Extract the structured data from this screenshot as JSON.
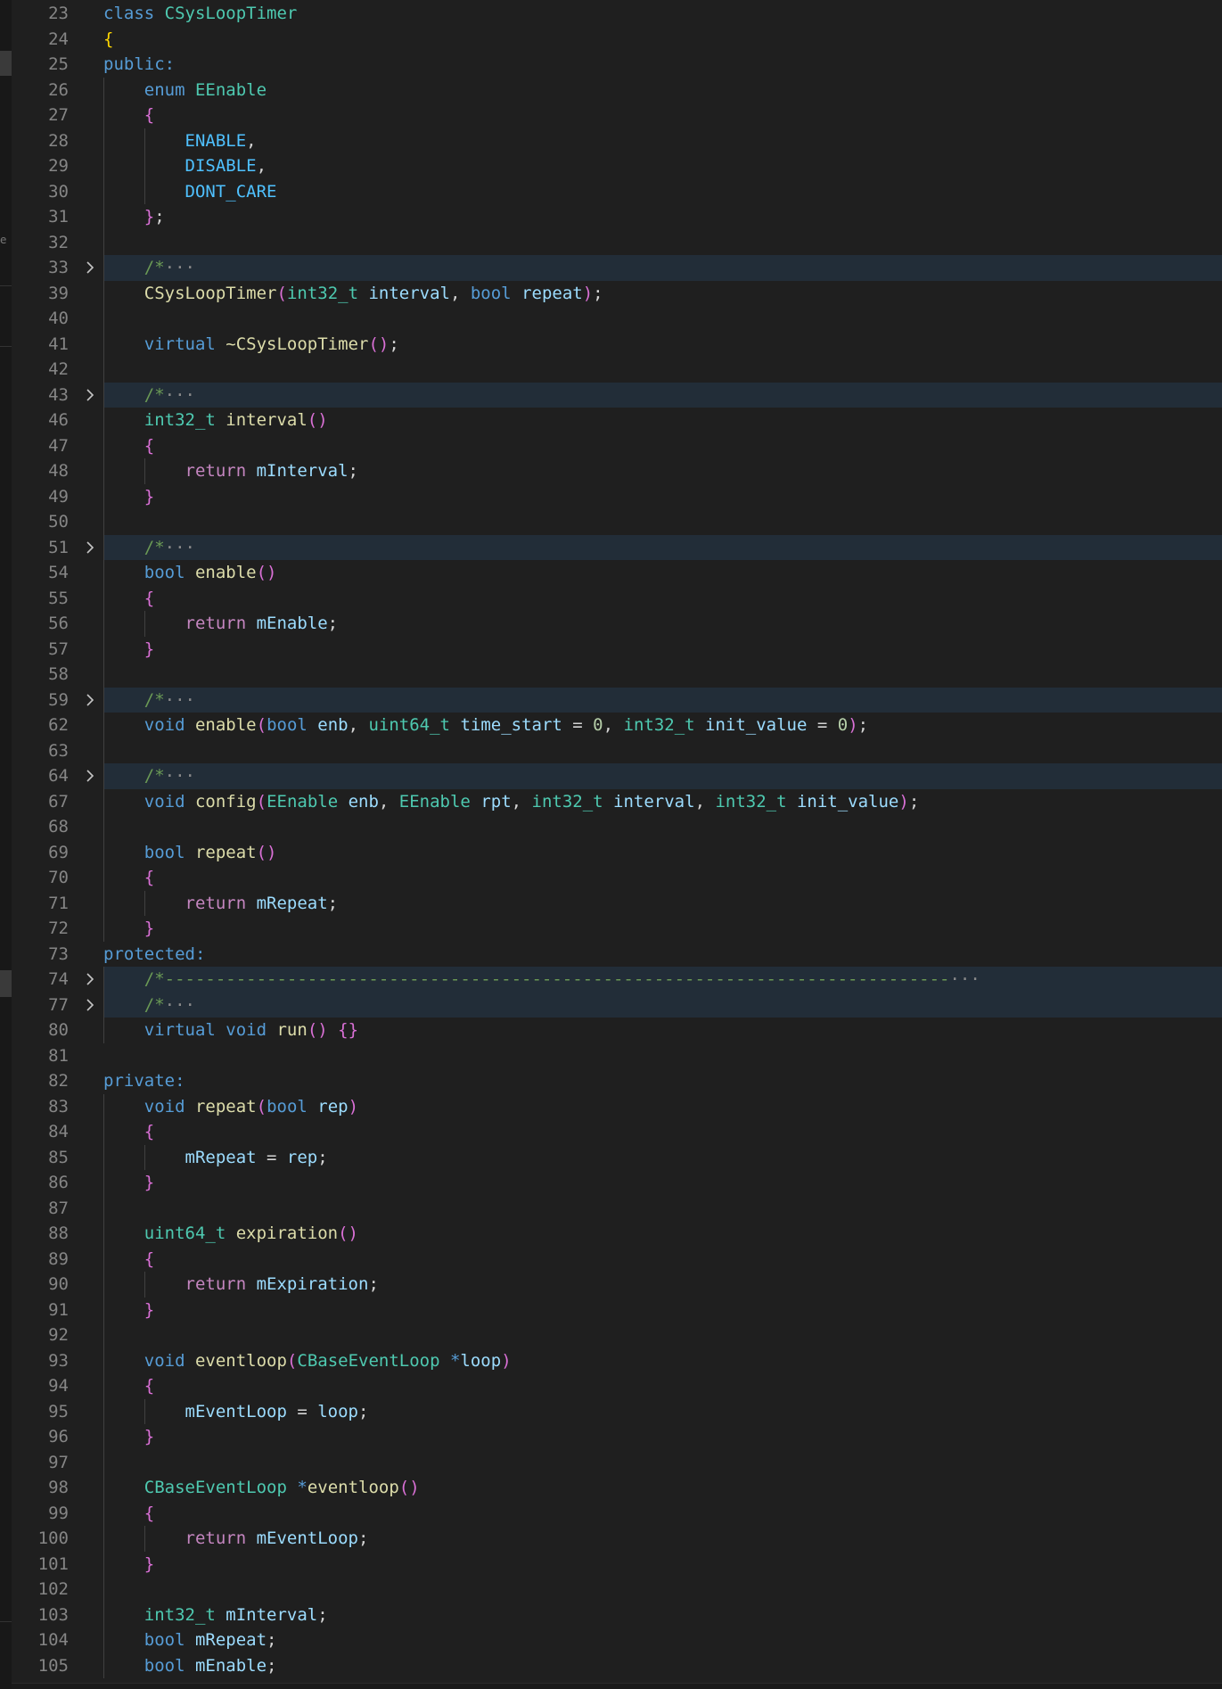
{
  "editor": {
    "language": "cpp",
    "side_strip_glyph": "e",
    "lines": [
      {
        "n": "23",
        "tokens": [
          [
            "class ",
            "kw"
          ],
          [
            "CSysLoopTimer",
            "type"
          ]
        ]
      },
      {
        "n": "24",
        "tokens": [
          [
            "{",
            "b1"
          ]
        ]
      },
      {
        "n": "25",
        "tokens": [
          [
            "public:",
            "kw"
          ]
        ]
      },
      {
        "n": "26",
        "tokens": [
          [
            "    ",
            "txt"
          ],
          [
            "enum ",
            "kw"
          ],
          [
            "EEnable",
            "type"
          ]
        ]
      },
      {
        "n": "27",
        "tokens": [
          [
            "    ",
            "txt"
          ],
          [
            "{",
            "b2"
          ]
        ]
      },
      {
        "n": "28",
        "tokens": [
          [
            "        ",
            "txt"
          ],
          [
            "ENABLE",
            "cst"
          ],
          [
            ",",
            "txt"
          ]
        ]
      },
      {
        "n": "29",
        "tokens": [
          [
            "        ",
            "txt"
          ],
          [
            "DISABLE",
            "cst"
          ],
          [
            ",",
            "txt"
          ]
        ]
      },
      {
        "n": "30",
        "tokens": [
          [
            "        ",
            "txt"
          ],
          [
            "DONT_CARE",
            "cst"
          ]
        ]
      },
      {
        "n": "31",
        "tokens": [
          [
            "    ",
            "txt"
          ],
          [
            "}",
            "b2"
          ],
          [
            ";",
            "txt"
          ]
        ]
      },
      {
        "n": "32",
        "tokens": []
      },
      {
        "n": "33",
        "folded": true,
        "tokens": [
          [
            "    ",
            "txt"
          ],
          [
            "/*",
            "cmt"
          ],
          [
            "···",
            "ell"
          ]
        ]
      },
      {
        "n": "39",
        "tokens": [
          [
            "    ",
            "txt"
          ],
          [
            "CSysLoopTimer",
            "fn"
          ],
          [
            "(",
            "b2"
          ],
          [
            "int32_t ",
            "type"
          ],
          [
            "interval",
            "var"
          ],
          [
            ", ",
            "txt"
          ],
          [
            "bool ",
            "kw"
          ],
          [
            "repeat",
            "var"
          ],
          [
            ")",
            "b2"
          ],
          [
            ";",
            "txt"
          ]
        ]
      },
      {
        "n": "40",
        "tokens": []
      },
      {
        "n": "41",
        "tokens": [
          [
            "    ",
            "txt"
          ],
          [
            "virtual ",
            "kw"
          ],
          [
            "~CSysLoopTimer",
            "fn"
          ],
          [
            "()",
            "b2"
          ],
          [
            ";",
            "txt"
          ]
        ]
      },
      {
        "n": "42",
        "tokens": []
      },
      {
        "n": "43",
        "folded": true,
        "tokens": [
          [
            "    ",
            "txt"
          ],
          [
            "/*",
            "cmt"
          ],
          [
            "···",
            "ell"
          ]
        ]
      },
      {
        "n": "46",
        "tokens": [
          [
            "    ",
            "txt"
          ],
          [
            "int32_t ",
            "type"
          ],
          [
            "interval",
            "fn"
          ],
          [
            "()",
            "b2"
          ]
        ]
      },
      {
        "n": "47",
        "tokens": [
          [
            "    ",
            "txt"
          ],
          [
            "{",
            "b2"
          ]
        ]
      },
      {
        "n": "48",
        "tokens": [
          [
            "        ",
            "txt"
          ],
          [
            "return ",
            "ctl"
          ],
          [
            "mInterval",
            "var"
          ],
          [
            ";",
            "txt"
          ]
        ]
      },
      {
        "n": "49",
        "tokens": [
          [
            "    ",
            "txt"
          ],
          [
            "}",
            "b2"
          ]
        ]
      },
      {
        "n": "50",
        "tokens": []
      },
      {
        "n": "51",
        "folded": true,
        "tokens": [
          [
            "    ",
            "txt"
          ],
          [
            "/*",
            "cmt"
          ],
          [
            "···",
            "ell"
          ]
        ]
      },
      {
        "n": "54",
        "tokens": [
          [
            "    ",
            "txt"
          ],
          [
            "bool ",
            "kw"
          ],
          [
            "enable",
            "fn"
          ],
          [
            "()",
            "b2"
          ]
        ]
      },
      {
        "n": "55",
        "tokens": [
          [
            "    ",
            "txt"
          ],
          [
            "{",
            "b2"
          ]
        ]
      },
      {
        "n": "56",
        "tokens": [
          [
            "        ",
            "txt"
          ],
          [
            "return ",
            "ctl"
          ],
          [
            "mEnable",
            "var"
          ],
          [
            ";",
            "txt"
          ]
        ]
      },
      {
        "n": "57",
        "tokens": [
          [
            "    ",
            "txt"
          ],
          [
            "}",
            "b2"
          ]
        ]
      },
      {
        "n": "58",
        "tokens": []
      },
      {
        "n": "59",
        "folded": true,
        "tokens": [
          [
            "    ",
            "txt"
          ],
          [
            "/*",
            "cmt"
          ],
          [
            "···",
            "ell"
          ]
        ]
      },
      {
        "n": "62",
        "tokens": [
          [
            "    ",
            "txt"
          ],
          [
            "void ",
            "kw"
          ],
          [
            "enable",
            "fn"
          ],
          [
            "(",
            "b2"
          ],
          [
            "bool ",
            "kw"
          ],
          [
            "enb",
            "var"
          ],
          [
            ", ",
            "txt"
          ],
          [
            "uint64_t ",
            "type"
          ],
          [
            "time_start",
            "var"
          ],
          [
            " = ",
            "txt"
          ],
          [
            "0",
            "num"
          ],
          [
            ", ",
            "txt"
          ],
          [
            "int32_t ",
            "type"
          ],
          [
            "init_value",
            "var"
          ],
          [
            " = ",
            "txt"
          ],
          [
            "0",
            "num"
          ],
          [
            ")",
            "b2"
          ],
          [
            ";",
            "txt"
          ]
        ]
      },
      {
        "n": "63",
        "tokens": []
      },
      {
        "n": "64",
        "folded": true,
        "tokens": [
          [
            "    ",
            "txt"
          ],
          [
            "/*",
            "cmt"
          ],
          [
            "···",
            "ell"
          ]
        ]
      },
      {
        "n": "67",
        "tokens": [
          [
            "    ",
            "txt"
          ],
          [
            "void ",
            "kw"
          ],
          [
            "config",
            "fn"
          ],
          [
            "(",
            "b2"
          ],
          [
            "EEnable ",
            "type"
          ],
          [
            "enb",
            "var"
          ],
          [
            ", ",
            "txt"
          ],
          [
            "EEnable ",
            "type"
          ],
          [
            "rpt",
            "var"
          ],
          [
            ", ",
            "txt"
          ],
          [
            "int32_t ",
            "type"
          ],
          [
            "interval",
            "var"
          ],
          [
            ", ",
            "txt"
          ],
          [
            "int32_t ",
            "type"
          ],
          [
            "init_value",
            "var"
          ],
          [
            ")",
            "b2"
          ],
          [
            ";",
            "txt"
          ]
        ]
      },
      {
        "n": "68",
        "tokens": []
      },
      {
        "n": "69",
        "tokens": [
          [
            "    ",
            "txt"
          ],
          [
            "bool ",
            "kw"
          ],
          [
            "repeat",
            "fn"
          ],
          [
            "()",
            "b2"
          ]
        ]
      },
      {
        "n": "70",
        "tokens": [
          [
            "    ",
            "txt"
          ],
          [
            "{",
            "b2"
          ]
        ]
      },
      {
        "n": "71",
        "tokens": [
          [
            "        ",
            "txt"
          ],
          [
            "return ",
            "ctl"
          ],
          [
            "mRepeat",
            "var"
          ],
          [
            ";",
            "txt"
          ]
        ]
      },
      {
        "n": "72",
        "tokens": [
          [
            "    ",
            "txt"
          ],
          [
            "}",
            "b2"
          ]
        ]
      },
      {
        "n": "73",
        "tokens": [
          [
            "protected:",
            "kw"
          ]
        ]
      },
      {
        "n": "74",
        "folded": true,
        "tokens": [
          [
            "    ",
            "txt"
          ],
          [
            "/*-----------------------------------------------------------------------------",
            "cmt"
          ],
          [
            "···",
            "ell"
          ]
        ]
      },
      {
        "n": "77",
        "folded": true,
        "tokens": [
          [
            "    ",
            "txt"
          ],
          [
            "/*",
            "cmt"
          ],
          [
            "···",
            "ell"
          ]
        ]
      },
      {
        "n": "80",
        "tokens": [
          [
            "    ",
            "txt"
          ],
          [
            "virtual ",
            "kw"
          ],
          [
            "void ",
            "kw"
          ],
          [
            "run",
            "fn"
          ],
          [
            "()",
            "b2"
          ],
          [
            " ",
            "txt"
          ],
          [
            "{}",
            "b2"
          ]
        ]
      },
      {
        "n": "81",
        "tokens": []
      },
      {
        "n": "82",
        "tokens": [
          [
            "private:",
            "kw"
          ]
        ]
      },
      {
        "n": "83",
        "tokens": [
          [
            "    ",
            "txt"
          ],
          [
            "void ",
            "kw"
          ],
          [
            "repeat",
            "fn"
          ],
          [
            "(",
            "b2"
          ],
          [
            "bool ",
            "kw"
          ],
          [
            "rep",
            "var"
          ],
          [
            ")",
            "b2"
          ]
        ]
      },
      {
        "n": "84",
        "tokens": [
          [
            "    ",
            "txt"
          ],
          [
            "{",
            "b2"
          ]
        ]
      },
      {
        "n": "85",
        "tokens": [
          [
            "        ",
            "txt"
          ],
          [
            "mRepeat",
            "var"
          ],
          [
            " = ",
            "txt"
          ],
          [
            "rep",
            "var"
          ],
          [
            ";",
            "txt"
          ]
        ]
      },
      {
        "n": "86",
        "tokens": [
          [
            "    ",
            "txt"
          ],
          [
            "}",
            "b2"
          ]
        ]
      },
      {
        "n": "87",
        "tokens": []
      },
      {
        "n": "88",
        "tokens": [
          [
            "    ",
            "txt"
          ],
          [
            "uint64_t ",
            "type"
          ],
          [
            "expiration",
            "fn"
          ],
          [
            "()",
            "b2"
          ]
        ]
      },
      {
        "n": "89",
        "tokens": [
          [
            "    ",
            "txt"
          ],
          [
            "{",
            "b2"
          ]
        ]
      },
      {
        "n": "90",
        "tokens": [
          [
            "        ",
            "txt"
          ],
          [
            "return ",
            "ctl"
          ],
          [
            "mExpiration",
            "var"
          ],
          [
            ";",
            "txt"
          ]
        ]
      },
      {
        "n": "91",
        "tokens": [
          [
            "    ",
            "txt"
          ],
          [
            "}",
            "b2"
          ]
        ]
      },
      {
        "n": "92",
        "tokens": []
      },
      {
        "n": "93",
        "tokens": [
          [
            "    ",
            "txt"
          ],
          [
            "void ",
            "kw"
          ],
          [
            "eventloop",
            "fn"
          ],
          [
            "(",
            "b2"
          ],
          [
            "CBaseEventLoop ",
            "type"
          ],
          [
            "*",
            "kw"
          ],
          [
            "loop",
            "var"
          ],
          [
            ")",
            "b2"
          ]
        ]
      },
      {
        "n": "94",
        "tokens": [
          [
            "    ",
            "txt"
          ],
          [
            "{",
            "b2"
          ]
        ]
      },
      {
        "n": "95",
        "tokens": [
          [
            "        ",
            "txt"
          ],
          [
            "mEventLoop",
            "var"
          ],
          [
            " = ",
            "txt"
          ],
          [
            "loop",
            "var"
          ],
          [
            ";",
            "txt"
          ]
        ]
      },
      {
        "n": "96",
        "tokens": [
          [
            "    ",
            "txt"
          ],
          [
            "}",
            "b2"
          ]
        ]
      },
      {
        "n": "97",
        "tokens": []
      },
      {
        "n": "98",
        "tokens": [
          [
            "    ",
            "txt"
          ],
          [
            "CBaseEventLoop ",
            "type"
          ],
          [
            "*",
            "kw"
          ],
          [
            "eventloop",
            "fn"
          ],
          [
            "()",
            "b2"
          ]
        ]
      },
      {
        "n": "99",
        "tokens": [
          [
            "    ",
            "txt"
          ],
          [
            "{",
            "b2"
          ]
        ]
      },
      {
        "n": "100",
        "tokens": [
          [
            "        ",
            "txt"
          ],
          [
            "return ",
            "ctl"
          ],
          [
            "mEventLoop",
            "var"
          ],
          [
            ";",
            "txt"
          ]
        ]
      },
      {
        "n": "101",
        "tokens": [
          [
            "    ",
            "txt"
          ],
          [
            "}",
            "b2"
          ]
        ]
      },
      {
        "n": "102",
        "tokens": []
      },
      {
        "n": "103",
        "tokens": [
          [
            "    ",
            "txt"
          ],
          [
            "int32_t ",
            "type"
          ],
          [
            "mInterval",
            "var"
          ],
          [
            ";",
            "txt"
          ]
        ]
      },
      {
        "n": "104",
        "tokens": [
          [
            "    ",
            "txt"
          ],
          [
            "bool ",
            "kw"
          ],
          [
            "mRepeat",
            "var"
          ],
          [
            ";",
            "txt"
          ]
        ]
      },
      {
        "n": "105",
        "tokens": [
          [
            "    ",
            "txt"
          ],
          [
            "bool ",
            "kw"
          ],
          [
            "mEnable",
            "var"
          ],
          [
            ";",
            "txt"
          ]
        ]
      }
    ]
  },
  "colors": {
    "background": "#1f1f1f",
    "line_number": "#858585",
    "fold_highlight": "#222d38",
    "keyword": "#569cd6",
    "control": "#c586c0",
    "type": "#4ec9b0",
    "function": "#dcdcaa",
    "variable": "#9cdcfe",
    "constant": "#4fc1ff",
    "number": "#b5cea8",
    "comment": "#6a9955",
    "bracket_level1": "#ffd700",
    "bracket_level2": "#da70d6"
  },
  "icons": {
    "fold": "chevron-right-icon"
  }
}
